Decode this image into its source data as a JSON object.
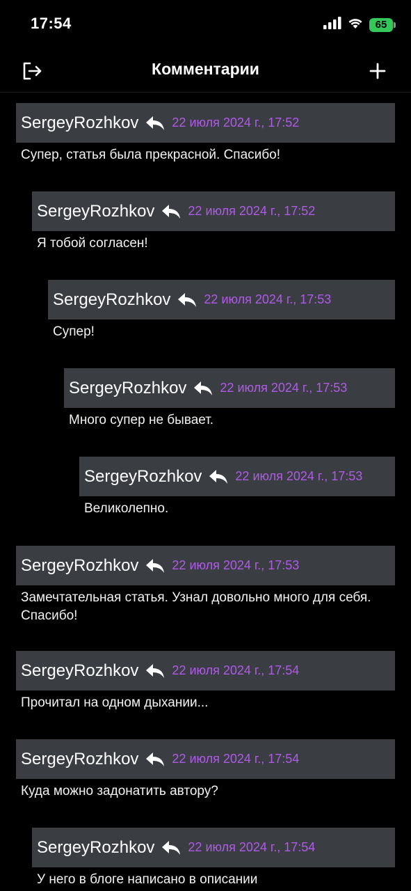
{
  "status_bar": {
    "time": "17:54",
    "battery": "65"
  },
  "header": {
    "title": "Комментарии"
  },
  "comments": [
    {
      "author": "SergeyRozhkov",
      "date": "22 июля 2024 г., 17:52",
      "text": "Супер, статья была прекрасной. Спасибо!"
    },
    {
      "author": "SergeyRozhkov",
      "date": "22 июля 2024 г., 17:52",
      "text": "Я тобой согласен!"
    },
    {
      "author": "SergeyRozhkov",
      "date": "22 июля 2024 г., 17:53",
      "text": "Супер!"
    },
    {
      "author": "SergeyRozhkov",
      "date": "22 июля 2024 г., 17:53",
      "text": "Много супер не бывает."
    },
    {
      "author": "SergeyRozhkov",
      "date": "22 июля 2024 г., 17:53",
      "text": "Великолепно."
    },
    {
      "author": "SergeyRozhkov",
      "date": "22 июля 2024 г., 17:53",
      "text": "Замечтательная статья. Узнал довольно много для себя. Спасибо!"
    },
    {
      "author": "SergeyRozhkov",
      "date": "22 июля 2024 г., 17:54",
      "text": "Прочитал на одном дыхании..."
    },
    {
      "author": "SergeyRozhkov",
      "date": "22 июля 2024 г., 17:54",
      "text": "Куда можно задонатить автору?"
    },
    {
      "author": "SergeyRozhkov",
      "date": "22 июля 2024 г., 17:54",
      "text": "У него в блоге написано в описании"
    }
  ]
}
